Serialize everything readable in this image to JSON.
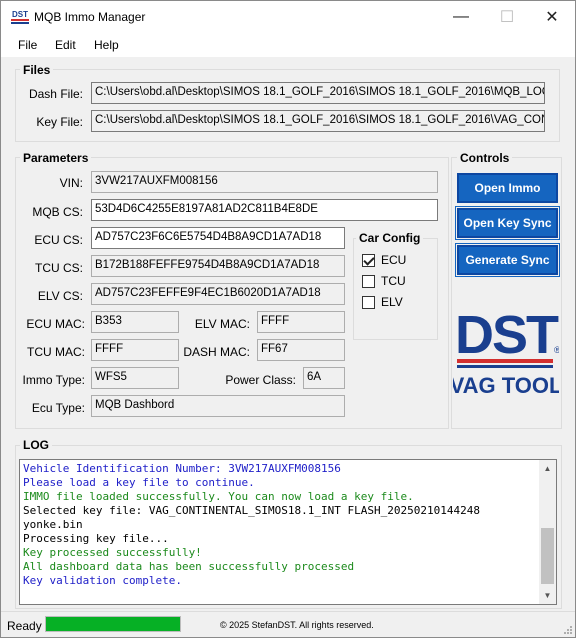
{
  "window": {
    "title": "MQB Immo Manager",
    "logo_text": "DST",
    "controls": {
      "minimize": "—",
      "maximize": "☐",
      "close": "✕"
    }
  },
  "menu": {
    "file": "File",
    "edit": "Edit",
    "help": "Help"
  },
  "files": {
    "title": "Files",
    "dash_label": "Dash File:",
    "dash_value": "C:\\Users\\obd.al\\Desktop\\SIMOS 18.1_GOLF_2016\\SIMOS 18.1_GOLF_2016\\MQB_LOCK",
    "key_label": "Key File:",
    "key_value": "C:\\Users\\obd.al\\Desktop\\SIMOS 18.1_GOLF_2016\\SIMOS 18.1_GOLF_2016\\VAG_CONTI"
  },
  "parameters": {
    "title": "Parameters",
    "vin_label": "VIN:",
    "vin_value": "3VW217AUXFM008156",
    "mqbcs_label": "MQB CS:",
    "mqbcs_value": "53D4D6C4255E8197A81AD2C811B4E8DE",
    "ecucs_label": "ECU CS:",
    "ecucs_value": "AD757C23F6C6E5754D4B8A9CD1A7AD18",
    "tcucs_label": "TCU CS:",
    "tcucs_value": "B172B188FEFFE9754D4B8A9CD1A7AD18",
    "elvcs_label": "ELV CS:",
    "elvcs_value": "AD757C23FEFFE9F4EC1B6020D1A7AD18",
    "ecumac_label": "ECU MAC:",
    "ecumac_value": "B353",
    "elvmac_label": "ELV MAC:",
    "elvmac_value": "FFFF",
    "tcumac_label": "TCU MAC:",
    "tcumac_value": "FFFF",
    "dashmac_label": "DASH MAC:",
    "dashmac_value": "FF67",
    "immotype_label": "Immo Type:",
    "immotype_value": "WFS5",
    "powerclass_label": "Power Class:",
    "powerclass_value": "6A",
    "ecutype_label": "Ecu Type:",
    "ecutype_value": "MQB Dashbord"
  },
  "car_config": {
    "title": "Car Config",
    "ecu": {
      "label": "ECU",
      "checked": true
    },
    "tcu": {
      "label": "TCU",
      "checked": false
    },
    "elv": {
      "label": "ELV",
      "checked": false
    }
  },
  "controls": {
    "title": "Controls",
    "open_immo": "Open Immo",
    "open_key_sync": "Open Key Sync",
    "generate_sync": "Generate Sync",
    "button_color": "#1565c0"
  },
  "brand": {
    "line1": "DST",
    "line2": "VAG TOOL",
    "registered": "®"
  },
  "log": {
    "title": "LOG",
    "lines": [
      {
        "text": "Vehicle Identification Number: 3VW217AUXFM008156",
        "color": "#1e1ec8"
      },
      {
        "text": "Please load a key file to continue.",
        "color": "#1e1ec8"
      },
      {
        "text": "IMMO file loaded successfully. You can now load a key file.",
        "color": "#1c8a1c"
      },
      {
        "text": "Selected key file: VAG_CONTINENTAL_SIMOS18.1_INT FLASH_20250210144248\nyonke.bin",
        "color": "#000000"
      },
      {
        "text": "Processing key file...",
        "color": "#000000"
      },
      {
        "text": "Key processed successfully!",
        "color": "#1c8a1c"
      },
      {
        "text": "All dashboard data has been successfully processed",
        "color": "#1c8a1c"
      },
      {
        "text": "Key validation complete.",
        "color": "#1e1ec8"
      }
    ]
  },
  "status": {
    "text": "Ready",
    "progress": 1.0,
    "progress_color": "#06b025",
    "copyright": "© 2025 StefanDST. All rights reserved."
  }
}
